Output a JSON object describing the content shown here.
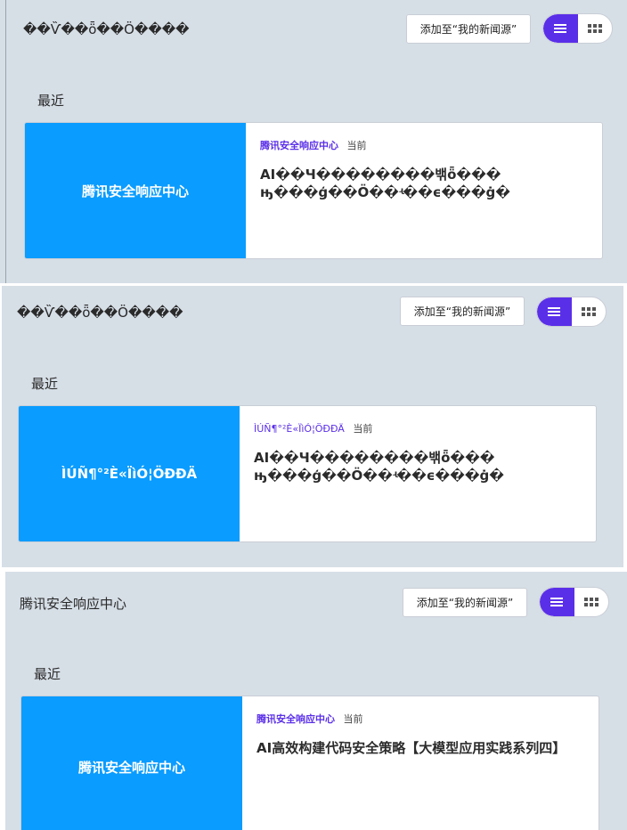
{
  "panels": [
    {
      "feed_title": "��Ѷ��ȫ��Ӧ����",
      "add_button": "添加至“我的新闻源”",
      "section_label": "最近",
      "card": {
        "thumb_text": "腾讯安全响应中心",
        "source": "腾讯安全响应中心",
        "time": "当前",
        "headline_line1": "AI��Ч��������밲ȫ���",
        "headline_line2": "ԣ���ģ��Ӧ��ʵ��ϵ���ġ�"
      }
    },
    {
      "feed_title": "��Ѷ��ȫ��Ӧ����",
      "add_button": "添加至“我的新闻源”",
      "section_label": "最近",
      "card": {
        "thumb_text": "ÌÚÑ¶°²È«ÏìÓ¦ÖÐÐÄ",
        "source": "ÌÚÑ¶°²È«ÏìÓ¦ÖÐÐÄ",
        "time": "当前",
        "headline_line1": "AI��Ч��������밲ȫ���",
        "headline_line2": "ԣ���ģ��Ӧ��ʵ��ϵ���ġ�"
      }
    },
    {
      "feed_title": "腾讯安全响应中心",
      "add_button": "添加至“我的新闻源”",
      "section_label": "最近",
      "card": {
        "thumb_text": "腾讯安全响应中心",
        "source": "腾讯安全响应中心",
        "time": "当前",
        "headline_line1": "AI高效构建代码安全策略【大模型应用实践系列四】",
        "headline_line2": ""
      }
    }
  ],
  "icons": {
    "list_view": "list-view-icon",
    "grid_view": "grid-view-icon"
  },
  "colors": {
    "accent": "#5a2fe8",
    "thumb": "#0a9cff",
    "panel_bg": "#d6dee6"
  }
}
